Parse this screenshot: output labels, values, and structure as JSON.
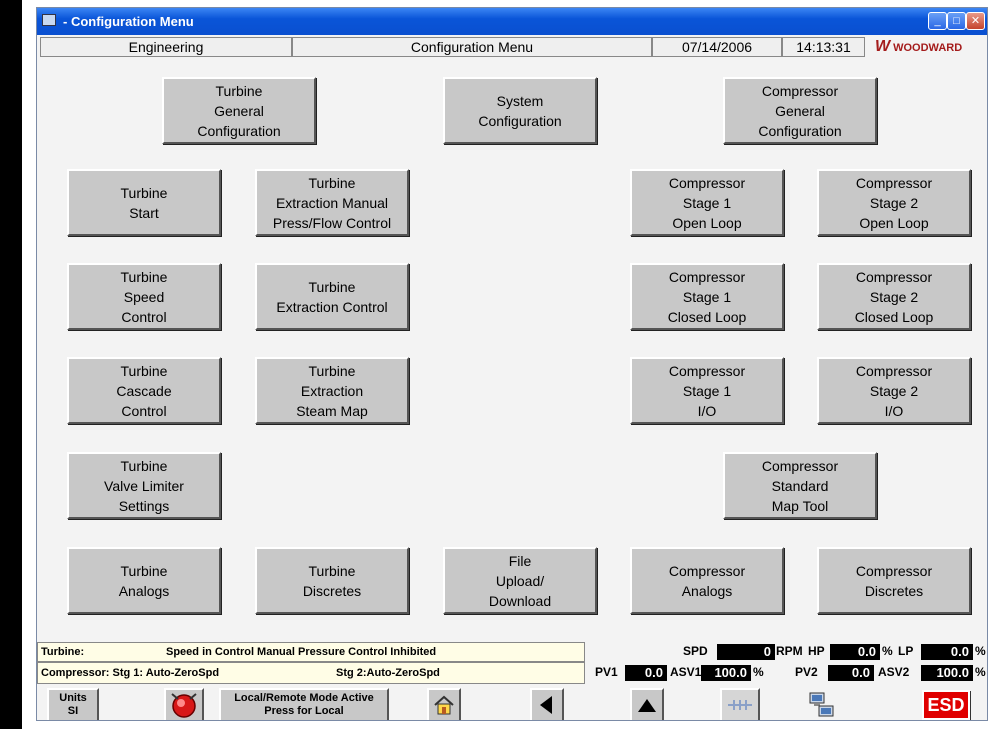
{
  "window": {
    "title": "- Configuration Menu"
  },
  "header": {
    "mode": "Engineering",
    "screen_title": "Configuration Menu",
    "date": "07/14/2006",
    "time": "14:13:31",
    "brand": "WOODWARD"
  },
  "buttons": {
    "turbine_general": "Turbine\nGeneral\nConfiguration",
    "system_config": "System\nConfiguration",
    "compressor_general": "Compressor\nGeneral\nConfiguration",
    "turbine_start": "Turbine\nStart",
    "turbine_extraction_manual": "Turbine\nExtraction Manual\nPress/Flow Control",
    "comp_s1_open": "Compressor\nStage 1\nOpen Loop",
    "comp_s2_open": "Compressor\nStage 2\nOpen Loop",
    "turbine_speed": "Turbine\nSpeed\nControl",
    "turbine_extraction_control": "Turbine\nExtraction Control",
    "comp_s1_closed": "Compressor\nStage 1\nClosed Loop",
    "comp_s2_closed": "Compressor\nStage 2\nClosed Loop",
    "turbine_cascade": "Turbine\nCascade\nControl",
    "turbine_steam_map": "Turbine\nExtraction\nSteam Map",
    "comp_s1_io": "Compressor\nStage 1\nI/O",
    "comp_s2_io": "Compressor\nStage 2\nI/O",
    "turbine_valve_limiter": "Turbine\nValve Limiter\nSettings",
    "comp_map_tool": "Compressor\nStandard\nMap Tool",
    "turbine_analogs": "Turbine\nAnalogs",
    "turbine_discretes": "Turbine\nDiscretes",
    "file_upload": "File\nUpload/\nDownload",
    "comp_analogs": "Compressor\nAnalogs",
    "comp_discretes": "Compressor\nDiscretes"
  },
  "status": {
    "turbine_label": "Turbine:",
    "turbine_text": "Speed in Control Manual Pressure Control Inhibited",
    "compressor_label": "Compressor: Stg 1: Auto-ZeroSpd",
    "compressor_stg2": "Stg 2:Auto-ZeroSpd"
  },
  "readouts": {
    "spd_label": "SPD",
    "spd_value": "0",
    "spd_unit": "RPM",
    "hp_label": "HP",
    "hp_value": "0.0",
    "hp_unit": "%",
    "lp_label": "LP",
    "lp_value": "0.0",
    "lp_unit": "%",
    "pv1_label": "PV1",
    "pv1_value": "0.0",
    "asv1_label": "ASV1",
    "asv1_value": "100.0",
    "asv1_unit": "%",
    "pv2_label": "PV2",
    "pv2_value": "0.0",
    "asv2_label": "ASV2",
    "asv2_value": "100.0",
    "asv2_unit": "%"
  },
  "toolbar": {
    "units_label": "Units",
    "units_value": "SI",
    "local_remote_line1": "Local/Remote Mode Active",
    "local_remote_line2": "Press for Local",
    "esd_label": "ESD"
  },
  "colors": {
    "titlebar": "#0a55d8",
    "button_face": "#c8c8c8",
    "esd_red": "#e00000",
    "brand_red": "#a41c1c"
  }
}
